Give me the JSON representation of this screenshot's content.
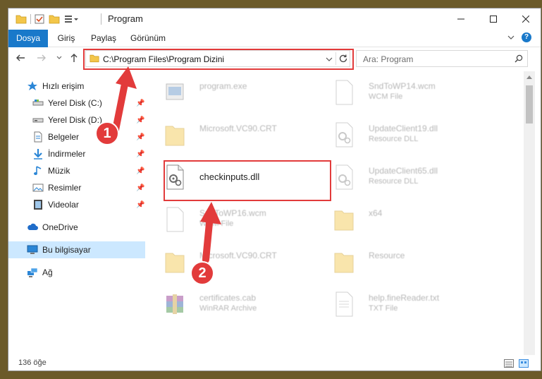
{
  "window": {
    "title": "Program"
  },
  "ribbon": {
    "tabs": [
      "Dosya",
      "Giriş",
      "Paylaş",
      "Görünüm"
    ]
  },
  "address": {
    "path": "C:\\Program Files\\Program Dizini"
  },
  "search": {
    "placeholder": "Ara: Program"
  },
  "sidebar": {
    "items": [
      {
        "label": "Hızlı erişim",
        "icon": "star-icon"
      },
      {
        "label": "Yerel Disk (C:)",
        "icon": "drive-icon",
        "pinned": true
      },
      {
        "label": "Yerel Disk (D:)",
        "icon": "drive-icon",
        "pinned": true
      },
      {
        "label": "Belgeler",
        "icon": "document-icon",
        "pinned": true
      },
      {
        "label": "İndirmeler",
        "icon": "download-icon",
        "pinned": true
      },
      {
        "label": "Müzik",
        "icon": "music-icon",
        "pinned": true
      },
      {
        "label": "Resimler",
        "icon": "picture-icon",
        "pinned": true
      },
      {
        "label": "Videolar",
        "icon": "video-icon",
        "pinned": true
      },
      {
        "label": "OneDrive",
        "icon": "cloud-icon"
      },
      {
        "label": "Bu bilgisayar",
        "icon": "computer-icon"
      },
      {
        "label": "Ağ",
        "icon": "network-icon"
      }
    ]
  },
  "files": [
    {
      "name": "program.exe",
      "sub": "",
      "icon": "exe-icon"
    },
    {
      "name": "SndToWP14.wcm",
      "sub": "WCM File",
      "icon": "blank-file-icon"
    },
    {
      "name": "Microsoft.VC90.CRT",
      "sub": "",
      "icon": "folder-icon"
    },
    {
      "name": "UpdateClient19.dll",
      "sub": "Resource DLL",
      "icon": "dll-icon"
    },
    {
      "name": "checkinputs.dll",
      "sub": "",
      "icon": "dll-icon"
    },
    {
      "name": "UpdateClient65.dll",
      "sub": "Resource DLL",
      "icon": "dll-icon"
    },
    {
      "name": "SndToWP16.wcm",
      "sub": "WCM File",
      "icon": "blank-file-icon"
    },
    {
      "name": "x64",
      "sub": "",
      "icon": "folder-icon"
    },
    {
      "name": "Microsoft.VC90.CRT",
      "sub": "",
      "icon": "folder-icon"
    },
    {
      "name": "Resource",
      "sub": "",
      "icon": "folder-icon"
    },
    {
      "name": "certificates.cab",
      "sub": "WinRAR Archive",
      "icon": "archive-icon"
    },
    {
      "name": "help.fineReader.txt",
      "sub": "TXT File",
      "icon": "text-file-icon"
    }
  ],
  "status": {
    "count": "136 öğe"
  },
  "annotations": {
    "step1": "1",
    "step2": "2"
  },
  "colors": {
    "accent": "#1979ca",
    "highlight": "#e23b3b",
    "selection": "#cce8ff"
  }
}
